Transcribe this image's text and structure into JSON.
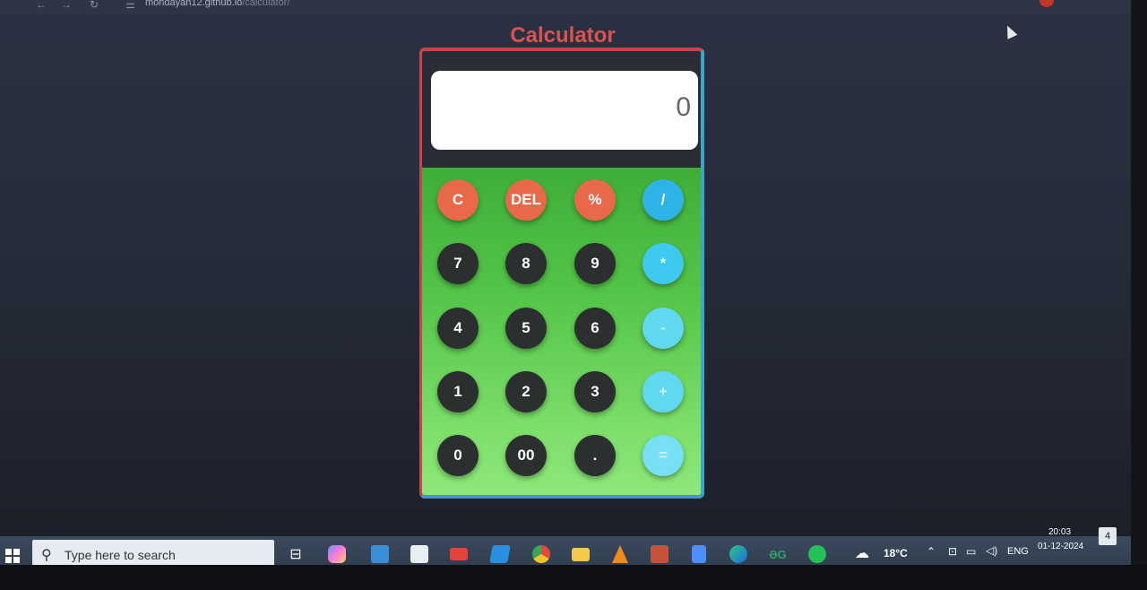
{
  "browser": {
    "url_host": "mohdayan12.github.io",
    "url_path": "/calculator/"
  },
  "calculator": {
    "title": "Calculator",
    "display_value": "0",
    "colors": {
      "title": "#d9534f",
      "function_key": "#e8684a",
      "digit_key": "#2b2f2f",
      "operator_key": "#2fb3e6",
      "keypad_top": "#3fae38",
      "keypad_bottom": "#8fe87c"
    },
    "keys": [
      {
        "label": "C",
        "style": "red"
      },
      {
        "label": "DEL",
        "style": "red"
      },
      {
        "label": "%",
        "style": "red"
      },
      {
        "label": "/",
        "style": "blue1"
      },
      {
        "label": "7",
        "style": "dark"
      },
      {
        "label": "8",
        "style": "dark"
      },
      {
        "label": "9",
        "style": "dark"
      },
      {
        "label": "*",
        "style": "blue2"
      },
      {
        "label": "4",
        "style": "dark"
      },
      {
        "label": "5",
        "style": "dark"
      },
      {
        "label": "6",
        "style": "dark"
      },
      {
        "label": "-",
        "style": "blue3"
      },
      {
        "label": "1",
        "style": "dark"
      },
      {
        "label": "2",
        "style": "dark"
      },
      {
        "label": "3",
        "style": "dark"
      },
      {
        "label": "+",
        "style": "blue3"
      },
      {
        "label": "0",
        "style": "dark"
      },
      {
        "label": "00",
        "style": "dark"
      },
      {
        "label": ".",
        "style": "dark"
      },
      {
        "label": "=",
        "style": "blue4"
      }
    ]
  },
  "taskbar": {
    "search_placeholder": "Type here to search",
    "apps": [
      "task-view-icon",
      "copilot-icon",
      "mail-icon",
      "store-icon",
      "youtube-icon",
      "vscode-icon",
      "chrome-icon",
      "file-explorer-icon",
      "vlc-icon",
      "powerpoint-icon",
      "docs-icon",
      "edge-icon",
      "geeksforgeeks-icon",
      "whatsapp-icon"
    ],
    "gfg_label": "ƏG",
    "weather": "18°C",
    "language": "ENG",
    "time": "20:03",
    "date": "01-12-2024",
    "notification_count": "4"
  }
}
